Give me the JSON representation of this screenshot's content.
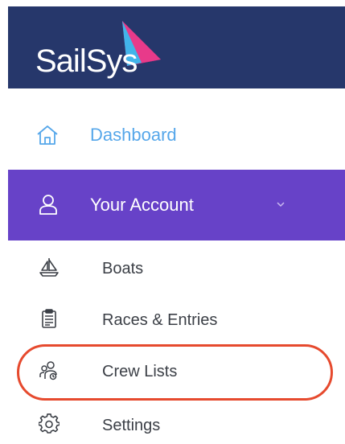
{
  "brand": {
    "logo_text": "SailSys",
    "colors": {
      "header_bg": "#26376b",
      "sail_pink": "#e83a8a",
      "sail_blue": "#41b4ea"
    }
  },
  "nav": {
    "dashboard": {
      "label": "Dashboard",
      "icon": "home-icon",
      "color": "#56a7ea"
    },
    "account": {
      "label": "Your Account",
      "icon": "user-icon",
      "expanded": true,
      "bg_color": "#6742c8",
      "submenu": [
        {
          "label": "Boats",
          "icon": "sailboat-icon"
        },
        {
          "label": "Races & Entries",
          "icon": "clipboard-icon"
        },
        {
          "label": "Crew Lists",
          "icon": "crew-icon",
          "highlighted": true
        },
        {
          "label": "Settings",
          "icon": "gear-icon"
        }
      ]
    }
  },
  "annotation": {
    "highlight_color": "#e64a2e"
  }
}
